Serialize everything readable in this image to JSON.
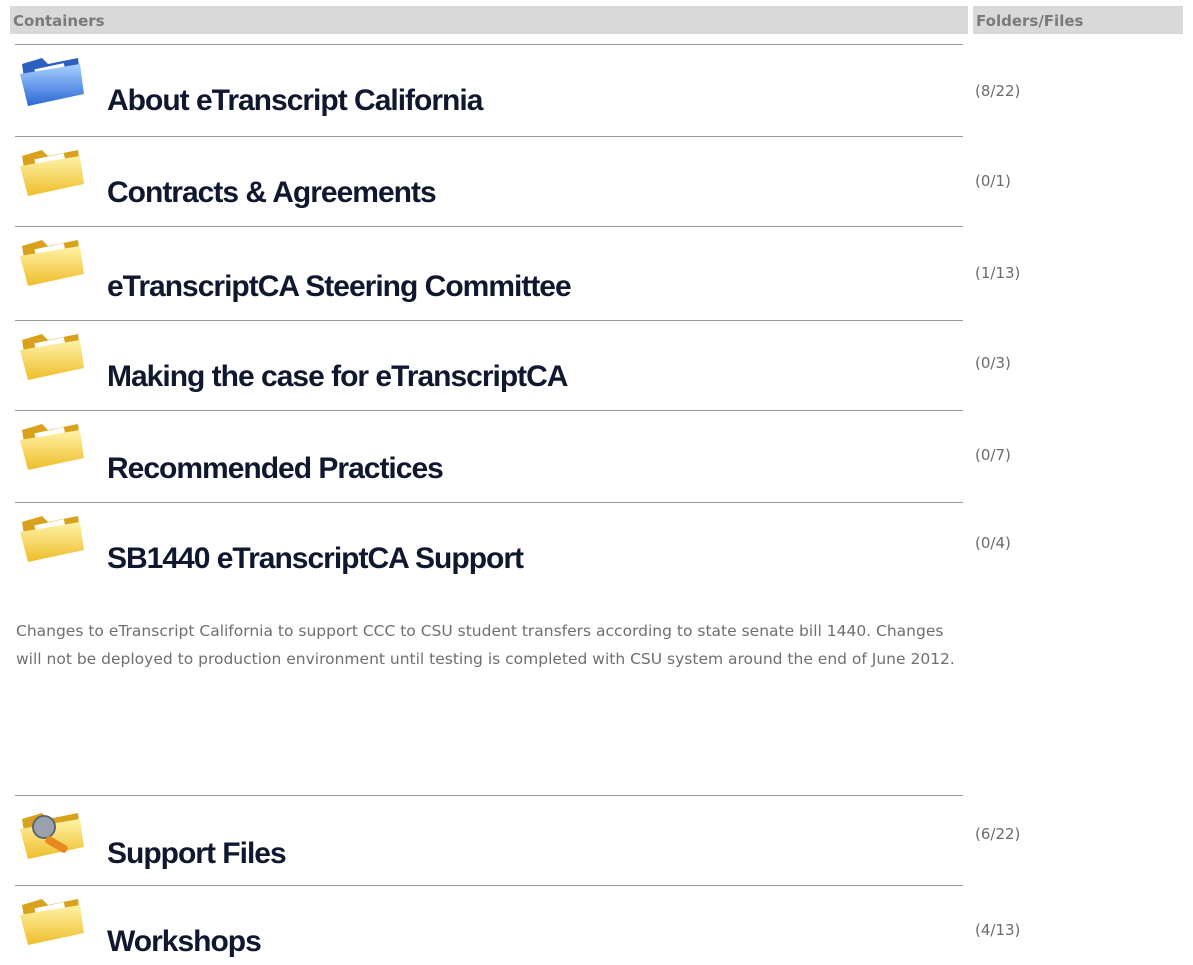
{
  "header": {
    "containers_label": "Containers",
    "folders_files_label": "Folders/Files"
  },
  "items": [
    {
      "title": "About eTranscript California",
      "count": "(8/22)",
      "icon": "folder-blue-icon"
    },
    {
      "title": "Contracts & Agreements",
      "count": "(0/1)",
      "icon": "folder-yellow-icon"
    },
    {
      "title": "eTranscriptCA Steering Committee",
      "count": "(1/13)",
      "icon": "folder-yellow-icon"
    },
    {
      "title": "Making the case for eTranscriptCA",
      "count": "(0/3)",
      "icon": "folder-yellow-icon"
    },
    {
      "title": "Recommended Practices",
      "count": "(0/7)",
      "icon": "folder-yellow-icon"
    },
    {
      "title": "SB1440 eTranscriptCA Support",
      "count": "(0/4)",
      "icon": "folder-yellow-icon",
      "description": "Changes to eTranscript California to support CCC to CSU student transfers according to state senate bill 1440. Changes will not be deployed to production environment until testing is completed with CSU system around the end of June 2012."
    },
    {
      "title": "Support Files",
      "count": "(6/22)",
      "icon": "folder-wrench-icon"
    },
    {
      "title": "Workshops",
      "count": "(4/13)",
      "icon": "folder-yellow-icon"
    }
  ],
  "colors": {
    "title": "#10182f",
    "count": "#6b6b6b",
    "header_bg": "#d9d9d9",
    "folder_yellow": "#f7d24a",
    "folder_blue": "#3f7fe0"
  }
}
